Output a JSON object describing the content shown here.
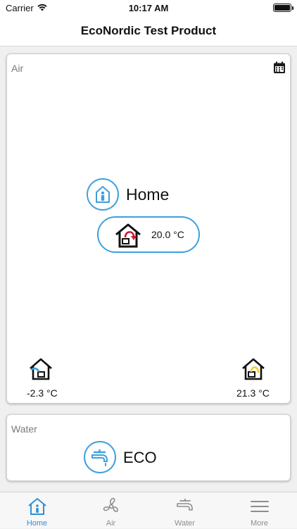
{
  "status_bar": {
    "carrier": "Carrier",
    "time": "10:17 AM"
  },
  "nav": {
    "title": "EcoNordic Test Product"
  },
  "air": {
    "label": "Air",
    "mode": "Home",
    "supply_temp": "20.0 °C",
    "outdoor_temp": "-2.3 °C",
    "extract_temp": "21.3 °C"
  },
  "water": {
    "label": "Water",
    "mode": "ECO"
  },
  "tabs": [
    {
      "label": "Home",
      "icon": "home-icon",
      "active": true
    },
    {
      "label": "Air",
      "icon": "fan-icon",
      "active": false
    },
    {
      "label": "Water",
      "icon": "faucet-icon",
      "active": false
    },
    {
      "label": "More",
      "icon": "menu-icon",
      "active": false
    }
  ],
  "colors": {
    "accent": "#3da0dd",
    "tab_active": "#2f8fd8",
    "supply_arrow": "#d0192f",
    "outdoor_accent": "#3da0dd",
    "extract_accent": "#f2d21b"
  }
}
